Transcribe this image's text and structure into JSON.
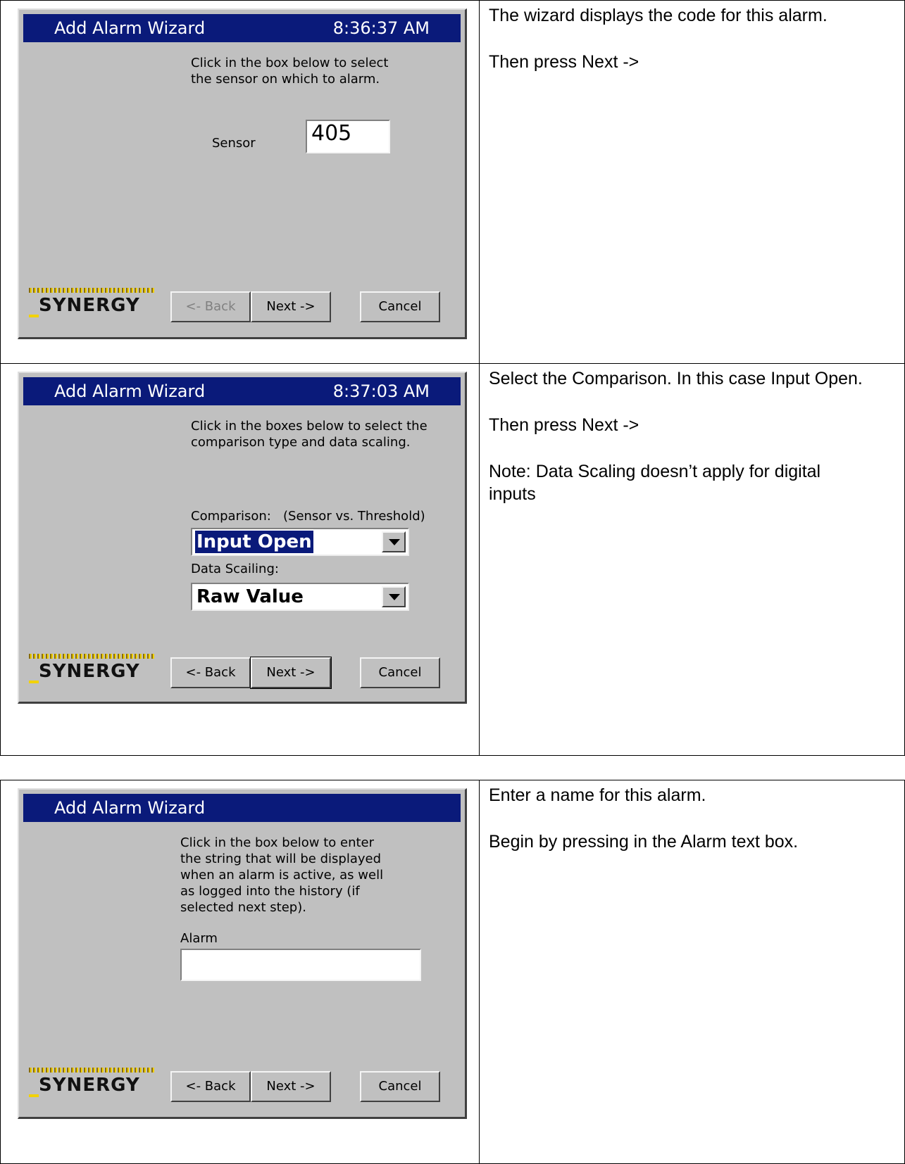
{
  "rows": [
    {
      "wizard": {
        "title": "Add Alarm Wizard",
        "time": "8:36:37 AM",
        "instruction": "Click in the box below to select\nthe sensor on which to alarm.",
        "sensor_label": "Sensor",
        "sensor_value": "405",
        "back": "<- Back",
        "next": "Next ->",
        "cancel": "Cancel",
        "logo": "SYNERGY"
      },
      "note": [
        "The wizard displays the code for this alarm.",
        "Then press Next ->"
      ]
    },
    {
      "wizard": {
        "title": "Add Alarm Wizard",
        "time": "8:37:03 AM",
        "instruction": "Click in the boxes below to select the\ncomparison type and data scaling.",
        "comparison_label": "Comparison:   (Sensor vs. Threshold)",
        "comparison_value": "Input Open",
        "scaling_label": "Data Scailing:",
        "scaling_value": "Raw Value",
        "back": "<- Back",
        "next": "Next ->",
        "cancel": "Cancel",
        "logo": "SYNERGY"
      },
      "note": [
        "Select the Comparison.  In this case Input Open.",
        "Then press Next ->",
        "Note: Data Scaling doesn’t apply for digital\ninputs"
      ]
    },
    {
      "wizard": {
        "title": "Add Alarm Wizard",
        "instruction": "Click in the box below to enter\nthe string that will be displayed\nwhen an alarm is active, as well\nas logged into the history (if\nselected next step).",
        "alarm_label": "Alarm",
        "alarm_value": "",
        "back": "<- Back",
        "next": "Next ->",
        "cancel": "Cancel",
        "logo": "SYNERGY"
      },
      "note": [
        "Enter a name for this alarm.",
        "Begin by pressing in the Alarm text box."
      ]
    }
  ]
}
